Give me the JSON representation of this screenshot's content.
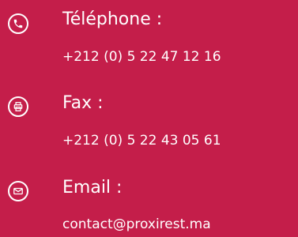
{
  "contacts": [
    {
      "icon": "phone-icon",
      "label": "Téléphone :",
      "value": "+212 (0) 5 22 47 12 16"
    },
    {
      "icon": "printer-icon",
      "label": "Fax :",
      "value": "+212 (0) 5 22 43 05 61"
    },
    {
      "icon": "envelope-icon",
      "label": "Email :",
      "value": "contact@proxirest.ma"
    }
  ],
  "colors": {
    "background": "#c41e4a",
    "text": "#ffffff"
  }
}
